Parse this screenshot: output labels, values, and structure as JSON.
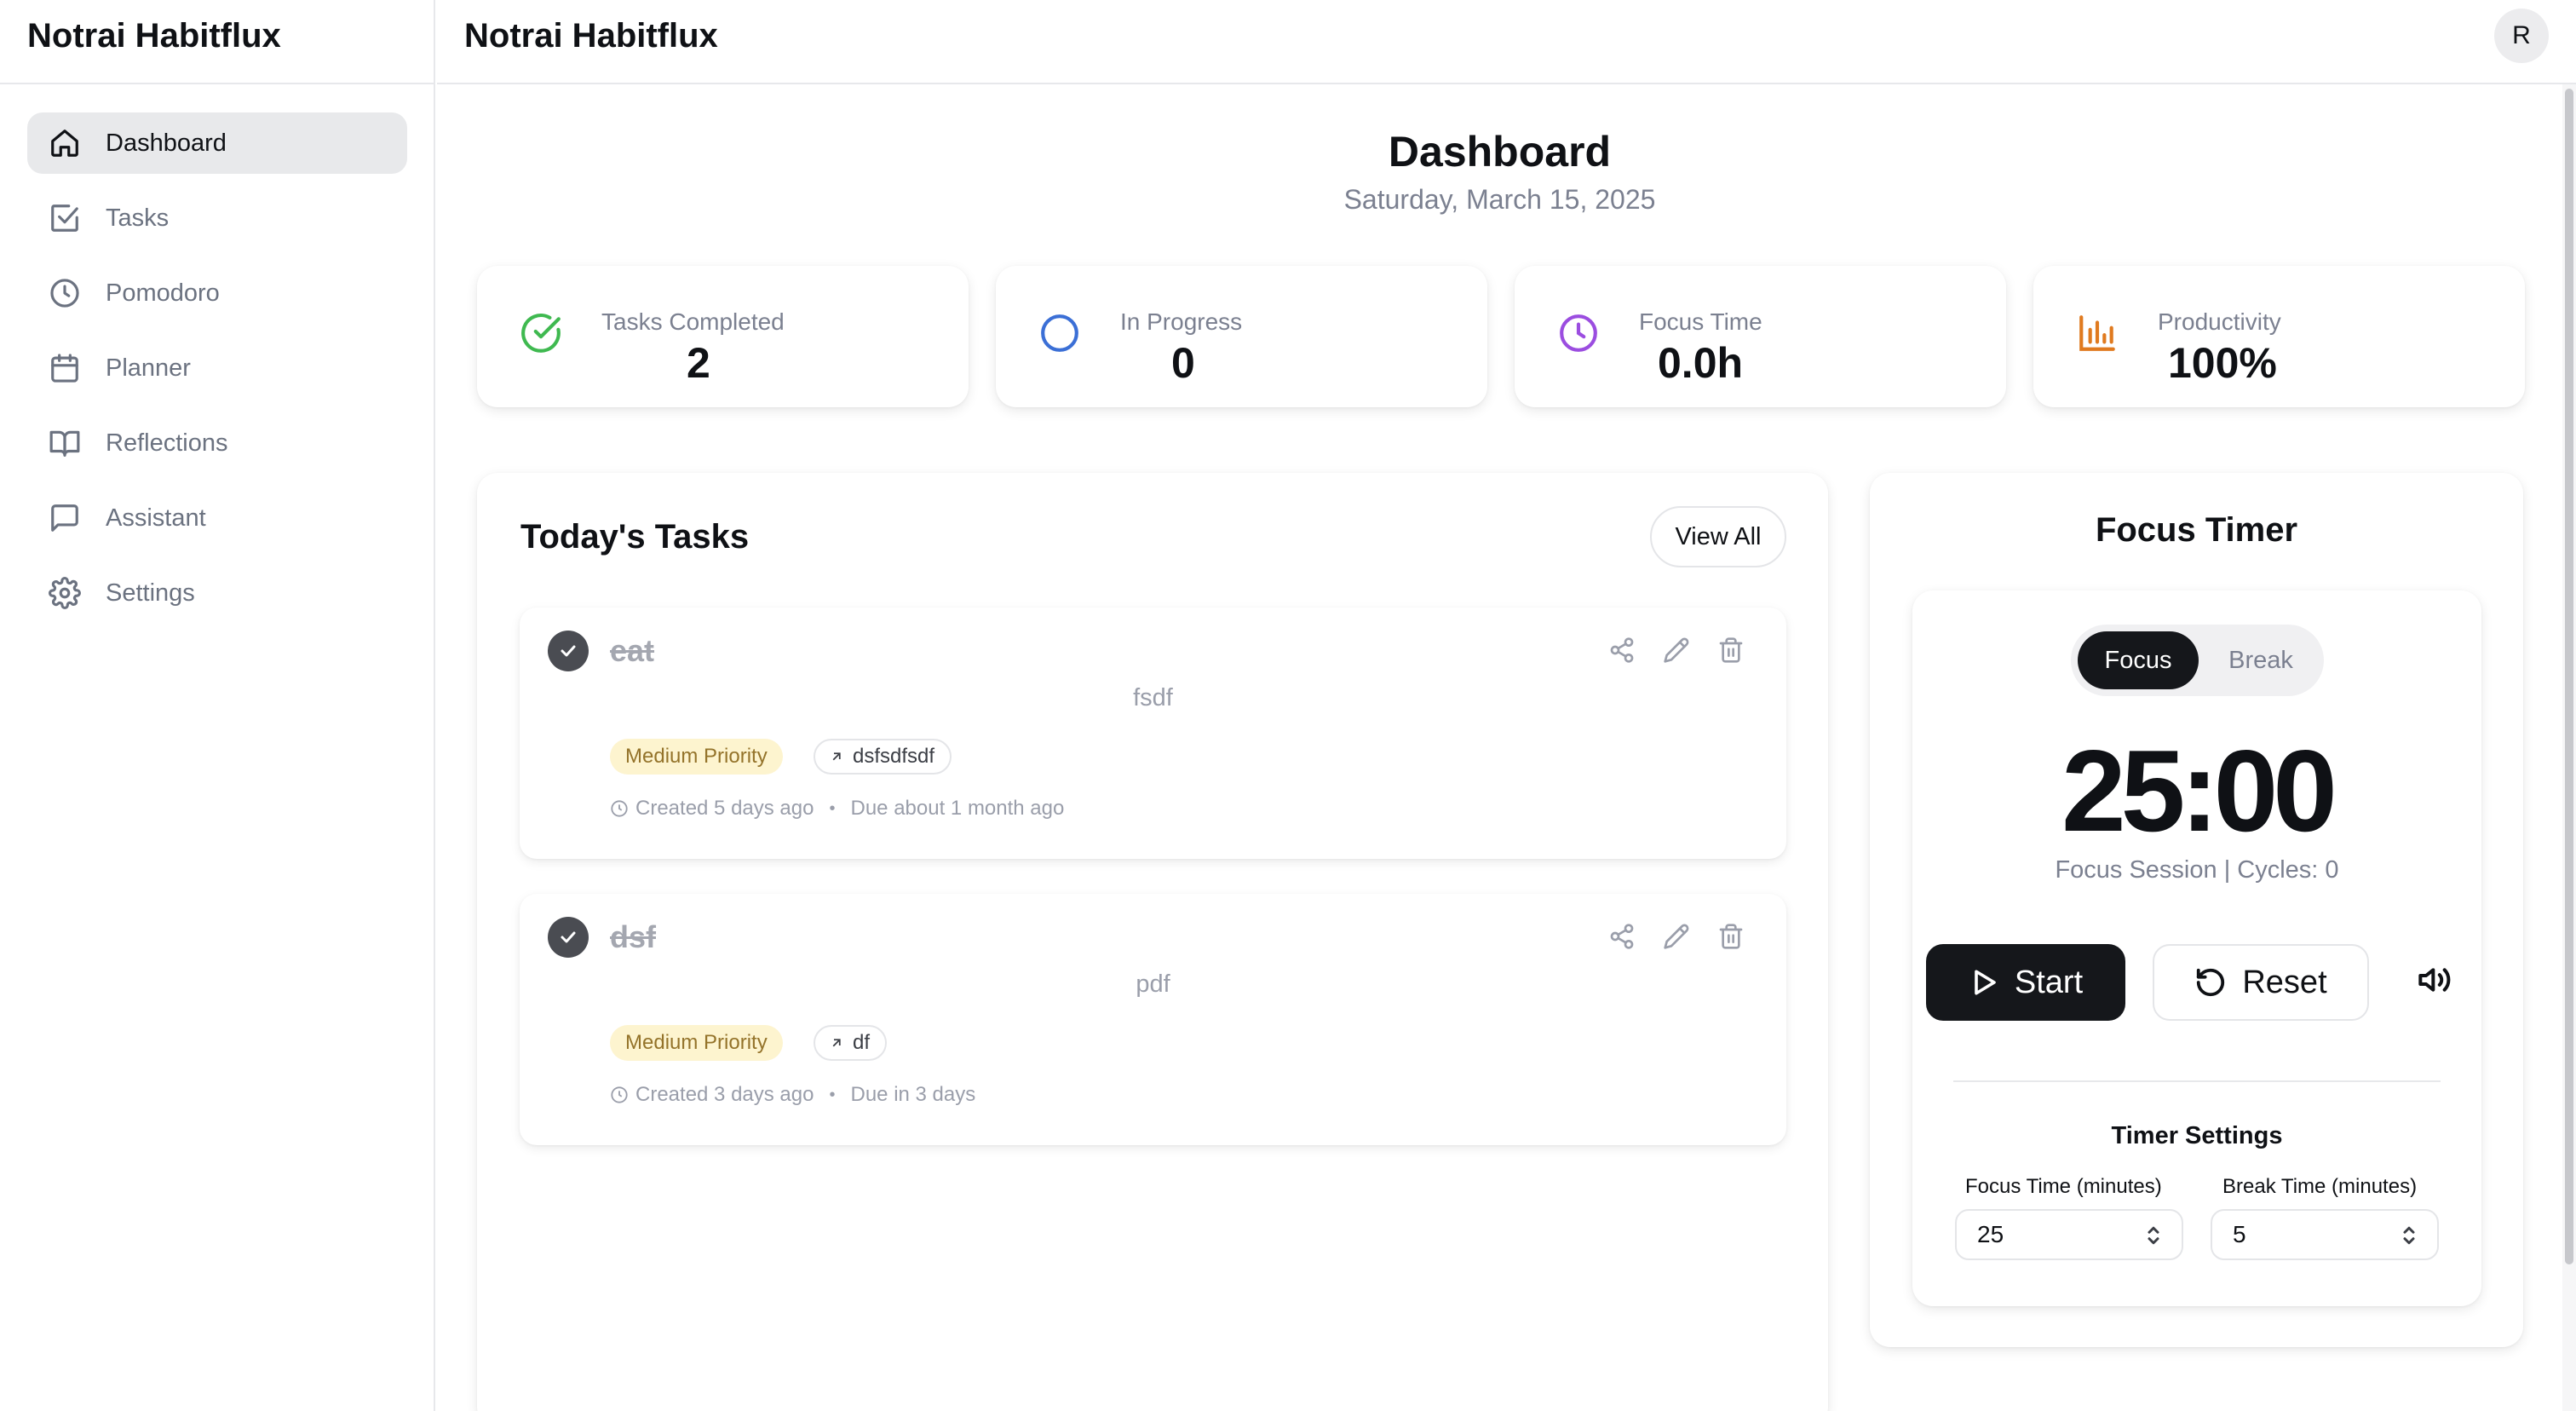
{
  "app": {
    "brand": "Notrai Habitflux",
    "header_title": "Notrai Habitflux",
    "avatar_initial": "R"
  },
  "sidebar": {
    "items": [
      {
        "label": "Dashboard",
        "icon": "home-icon",
        "active": true
      },
      {
        "label": "Tasks",
        "icon": "checkbox-icon"
      },
      {
        "label": "Pomodoro",
        "icon": "clock-icon"
      },
      {
        "label": "Planner",
        "icon": "calendar-icon"
      },
      {
        "label": "Reflections",
        "icon": "book-icon"
      },
      {
        "label": "Assistant",
        "icon": "chat-icon"
      },
      {
        "label": "Settings",
        "icon": "gear-icon"
      }
    ]
  },
  "page": {
    "title": "Dashboard",
    "date": "Saturday, March 15, 2025"
  },
  "stats": [
    {
      "label": "Tasks Completed",
      "value": "2",
      "icon": "check-circle-icon",
      "color": "#3fb950"
    },
    {
      "label": "In Progress",
      "value": "0",
      "icon": "circle-icon",
      "color": "#3b6fd6"
    },
    {
      "label": "Focus Time",
      "value": "0.0h",
      "icon": "clock-icon",
      "color": "#9b4de0"
    },
    {
      "label": "Productivity",
      "value": "100%",
      "icon": "bar-chart-icon",
      "color": "#e07a1f"
    }
  ],
  "tasks": {
    "heading": "Today's Tasks",
    "view_all": "View All",
    "items": [
      {
        "title": "eat",
        "description": "fsdf",
        "priority": "Medium Priority",
        "tag": "dsfsdfsdf",
        "created": "Created 5 days ago",
        "due": "Due about 1 month ago",
        "completed": true
      },
      {
        "title": "dsf",
        "description": "pdf",
        "priority": "Medium Priority",
        "tag": "df",
        "created": "Created 3 days ago",
        "due": "Due in 3 days",
        "completed": true
      }
    ]
  },
  "timer": {
    "heading": "Focus Timer",
    "mode_focus": "Focus",
    "mode_break": "Break",
    "display": "25:00",
    "subtitle": "Focus Session | Cycles: 0",
    "start_label": "Start",
    "reset_label": "Reset",
    "settings_heading": "Timer Settings",
    "focus_label": "Focus Time (minutes)",
    "break_label": "Break Time (minutes)",
    "focus_value": "25",
    "break_value": "5"
  }
}
